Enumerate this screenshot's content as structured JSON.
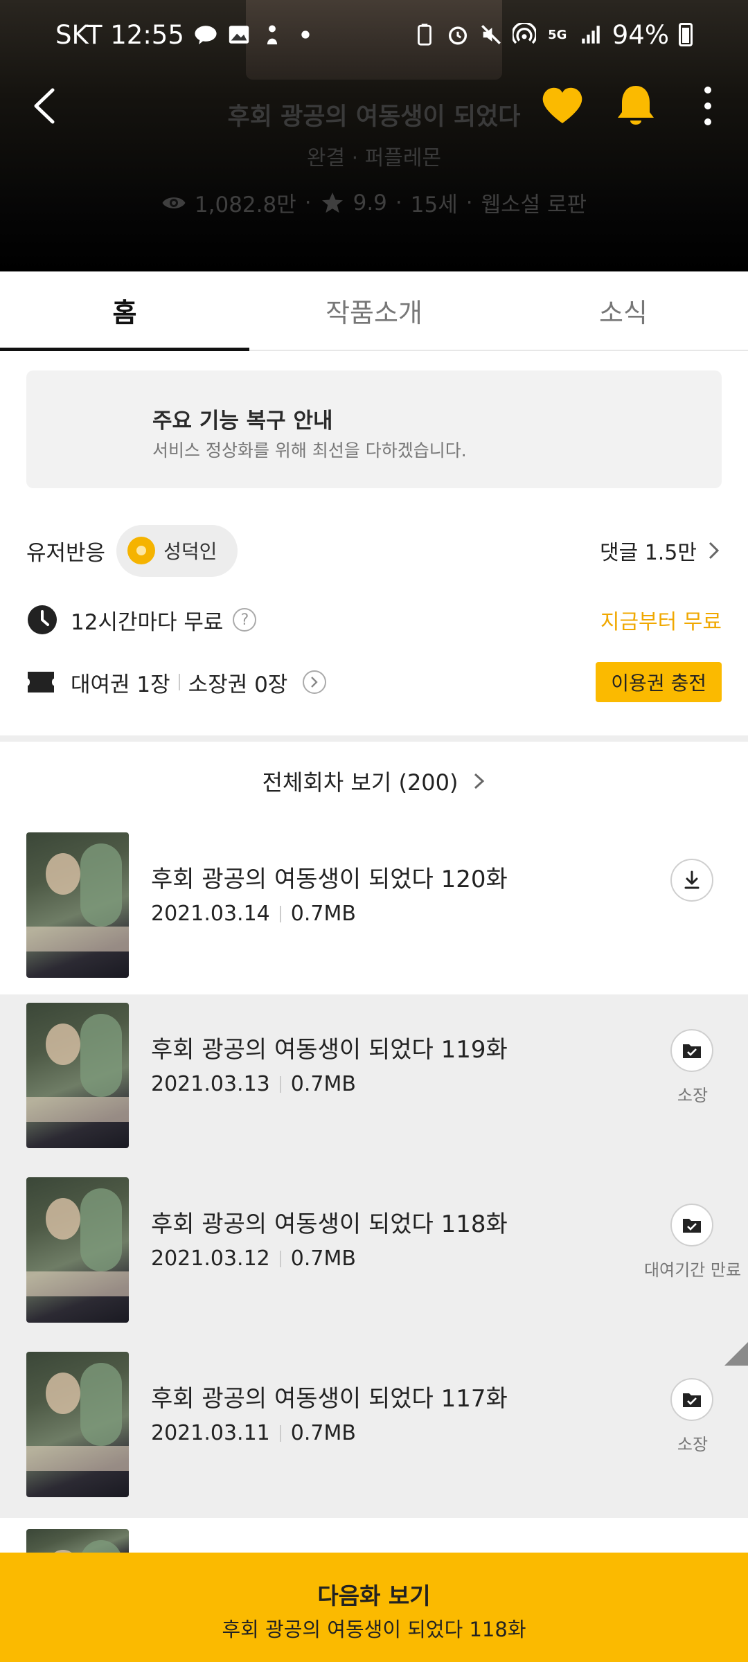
{
  "status_bar": {
    "carrier_time": "SKT 12:55",
    "network": "5G",
    "battery": "94%"
  },
  "header": {
    "title": "후회 광공의 여동생이 되었다",
    "subtitle": "완결 · 퍼플레몬",
    "views": "1,082.8만",
    "dot1": "·",
    "rating": "9.9",
    "dot2": "·",
    "age": "15세",
    "dot3": "·",
    "genre": "웹소설 로판"
  },
  "tabs": [
    {
      "label": "홈",
      "active": true
    },
    {
      "label": "작품소개",
      "active": false
    },
    {
      "label": "소식",
      "active": false
    }
  ],
  "notice": {
    "title": "주요 기능 복구 안내",
    "body": "서비스 정상화를 위해 최선을 다하겠습니다."
  },
  "user_reaction": {
    "label": "유저반응",
    "badge": "성덕인",
    "comments": "댓글 1.5만"
  },
  "free": {
    "label": "12시간마다 무료",
    "help": "?",
    "cta": "지금부터 무료"
  },
  "tickets": {
    "rental": "대여권 1장",
    "owned": "소장권 0장",
    "charge": "이용권 충전"
  },
  "all_episodes": "전체회차 보기 (200)",
  "episodes": [
    {
      "title": "후회 광공의 여동생이 되었다 120화",
      "date": "2021.03.14",
      "size": "0.7MB",
      "status": "",
      "icon": "download-icon",
      "read": false
    },
    {
      "title": "후회 광공의 여동생이 되었다 119화",
      "date": "2021.03.13",
      "size": "0.7MB",
      "status": "소장",
      "icon": "owned-folder-icon",
      "read": true
    },
    {
      "title": "후회 광공의 여동생이 되었다 118화",
      "date": "2021.03.12",
      "size": "0.7MB",
      "status": "대여기간 만료",
      "icon": "owned-folder-icon",
      "read": true
    },
    {
      "title": "후회 광공의 여동생이 되었다 117화",
      "date": "2021.03.11",
      "size": "0.7MB",
      "status": "소장",
      "icon": "owned-folder-icon",
      "read": true
    }
  ],
  "next": {
    "label": "다음화 보기",
    "episode": "후회 광공의 여동생이 되었다 118화"
  },
  "colors": {
    "accent": "#fbba00",
    "free_text": "#f0a800",
    "read_row_bg": "#eeeeee"
  }
}
